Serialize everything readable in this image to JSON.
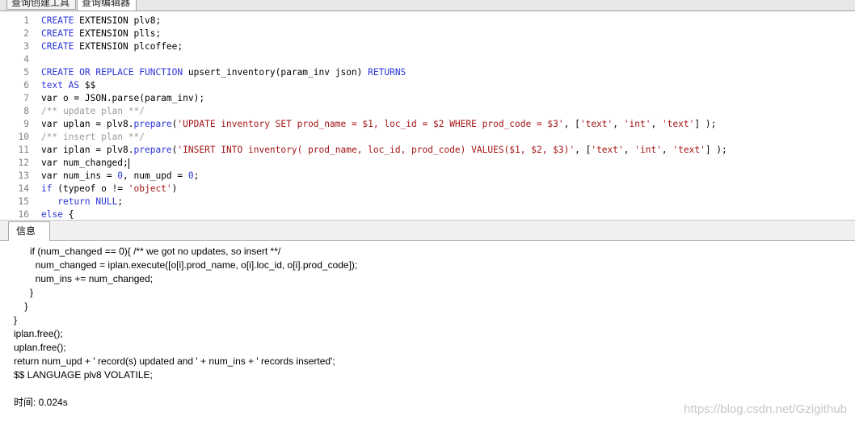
{
  "tabs": {
    "query_builder": "查询创建工具",
    "query_editor": "查询编辑器"
  },
  "editor": {
    "lines": [
      {
        "n": "1",
        "tokens": [
          [
            "kw",
            "CREATE"
          ],
          [
            "tx",
            " EXTENSION plv8;"
          ]
        ]
      },
      {
        "n": "2",
        "tokens": [
          [
            "kw",
            "CREATE"
          ],
          [
            "tx",
            " EXTENSION plls;"
          ]
        ]
      },
      {
        "n": "3",
        "tokens": [
          [
            "kw",
            "CREATE"
          ],
          [
            "tx",
            " EXTENSION plcoffee;"
          ]
        ]
      },
      {
        "n": "4",
        "tokens": []
      },
      {
        "n": "5",
        "tokens": [
          [
            "kw",
            "CREATE OR REPLACE FUNCTION"
          ],
          [
            "tx",
            " upsert_inventory(param_inv json) "
          ],
          [
            "kw",
            "RETURNS"
          ]
        ]
      },
      {
        "n": "6",
        "tokens": [
          [
            "kw",
            "text AS"
          ],
          [
            "tx",
            " $$"
          ]
        ]
      },
      {
        "n": "7",
        "tokens": [
          [
            "tx",
            "var o = JSON.parse(param_inv);"
          ]
        ]
      },
      {
        "n": "8",
        "tokens": [
          [
            "cm",
            "/** update plan **/"
          ]
        ]
      },
      {
        "n": "9",
        "tokens": [
          [
            "tx",
            "var uplan = plv8."
          ],
          [
            "kw",
            "prepare"
          ],
          [
            "tx",
            "("
          ],
          [
            "st",
            "'UPDATE inventory SET prod_name = $1, loc_id = $2 WHERE prod_code = $3'"
          ],
          [
            "tx",
            ", ["
          ],
          [
            "st",
            "'text'"
          ],
          [
            "tx",
            ", "
          ],
          [
            "st",
            "'int'"
          ],
          [
            "tx",
            ", "
          ],
          [
            "st",
            "'text'"
          ],
          [
            "tx",
            "] );"
          ]
        ]
      },
      {
        "n": "10",
        "tokens": [
          [
            "cm",
            "/** insert plan **/"
          ]
        ]
      },
      {
        "n": "11",
        "tokens": [
          [
            "tx",
            "var iplan = plv8."
          ],
          [
            "kw",
            "prepare"
          ],
          [
            "tx",
            "("
          ],
          [
            "st",
            "'INSERT INTO inventory( prod_name, loc_id, prod_code) VALUES($1, $2, $3)'"
          ],
          [
            "tx",
            ", ["
          ],
          [
            "st",
            "'text'"
          ],
          [
            "tx",
            ", "
          ],
          [
            "st",
            "'int'"
          ],
          [
            "tx",
            ", "
          ],
          [
            "st",
            "'text'"
          ],
          [
            "tx",
            "] );"
          ]
        ]
      },
      {
        "n": "12",
        "tokens": [
          [
            "tx",
            "var num_changed;"
          ]
        ],
        "caret": true
      },
      {
        "n": "13",
        "tokens": [
          [
            "tx",
            "var num_ins = "
          ],
          [
            "nm",
            "0"
          ],
          [
            "tx",
            ", num_upd = "
          ],
          [
            "nm",
            "0"
          ],
          [
            "tx",
            ";"
          ]
        ]
      },
      {
        "n": "14",
        "tokens": [
          [
            "kw",
            "if"
          ],
          [
            "tx",
            " (typeof o != "
          ],
          [
            "st",
            "'object'"
          ],
          [
            "tx",
            ")"
          ]
        ]
      },
      {
        "n": "15",
        "tokens": [
          [
            "tx",
            "   "
          ],
          [
            "kw",
            "return NULL"
          ],
          [
            "tx",
            ";"
          ]
        ]
      },
      {
        "n": "16",
        "tokens": [
          [
            "kw",
            "else"
          ],
          [
            "tx",
            " {"
          ]
        ]
      }
    ]
  },
  "info": {
    "tab_label": "信息",
    "output_lines": [
      "      if (num_changed == 0){ /** we got no updates, so insert **/",
      "        num_changed = iplan.execute([o[i].prod_name, o[i].loc_id, o[i].prod_code]);",
      "        num_ins += num_changed;",
      "      }",
      "    }",
      "}",
      "iplan.free();",
      "uplan.free();",
      "return num_upd + ' record(s) updated and ' + num_ins + ' records inserted';",
      "$$ LANGUAGE plv8 VOLATILE;",
      "",
      "时间: 0.024s"
    ]
  },
  "watermark": "https://blog.csdn.net/Gzigithub",
  "colors": {
    "keyword": "#2a36d8",
    "comment": "#9c9c9c",
    "string": "#a31515",
    "line_number": "#808080"
  }
}
